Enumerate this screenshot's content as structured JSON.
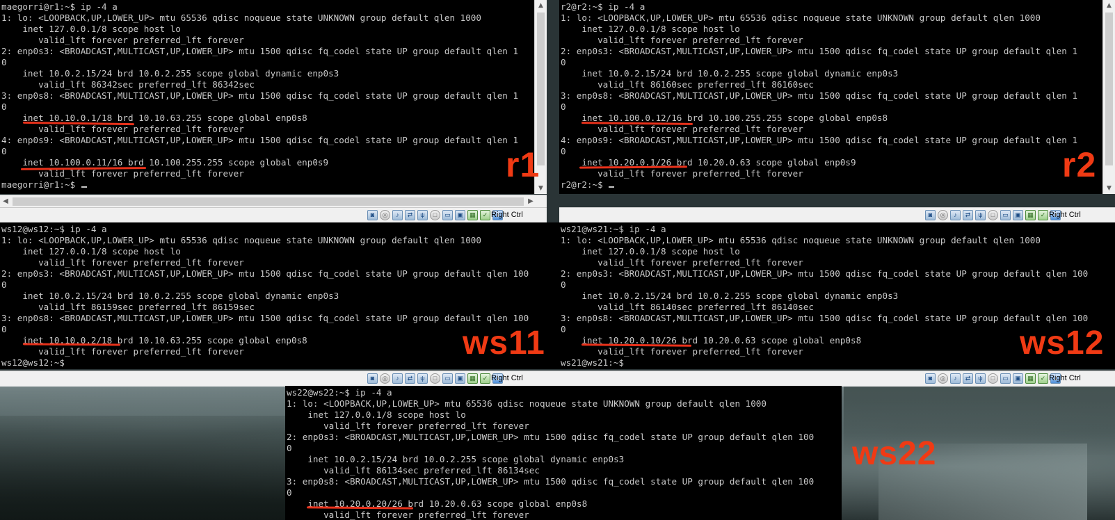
{
  "vms": {
    "r1": {
      "label": "r1",
      "prompt_line": "maegorri@r1:~$ ip -4 a",
      "lines": [
        "1: lo: <LOOPBACK,UP,LOWER_UP> mtu 65536 qdisc noqueue state UNKNOWN group default qlen 1000",
        "    inet 127.0.0.1/8 scope host lo",
        "       valid_lft forever preferred_lft forever",
        "2: enp0s3: <BROADCAST,MULTICAST,UP,LOWER_UP> mtu 1500 qdisc fq_codel state UP group default qlen 1",
        "0",
        "    inet 10.0.2.15/24 brd 10.0.2.255 scope global dynamic enp0s3",
        "       valid_lft 86342sec preferred_lft 86342sec",
        "3: enp0s8: <BROADCAST,MULTICAST,UP,LOWER_UP> mtu 1500 qdisc fq_codel state UP group default qlen 1",
        "0",
        "    inet 10.10.0.1/18 brd 10.10.63.255 scope global enp0s8",
        "       valid_lft forever preferred_lft forever",
        "4: enp0s9: <BROADCAST,MULTICAST,UP,LOWER_UP> mtu 1500 qdisc fq_codel state UP group default qlen 1",
        "0",
        "    inet 10.100.0.11/16 brd 10.100.255.255 scope global enp0s9",
        "       valid_lft forever preferred_lft forever"
      ],
      "final_prompt": "maegorri@r1:~$ "
    },
    "r2": {
      "label": "r2",
      "prompt_line": "r2@r2:~$ ip -4 a",
      "lines": [
        "1: lo: <LOOPBACK,UP,LOWER_UP> mtu 65536 qdisc noqueue state UNKNOWN group default qlen 1000",
        "    inet 127.0.0.1/8 scope host lo",
        "       valid_lft forever preferred_lft forever",
        "2: enp0s3: <BROADCAST,MULTICAST,UP,LOWER_UP> mtu 1500 qdisc fq_codel state UP group default qlen 1",
        "0",
        "    inet 10.0.2.15/24 brd 10.0.2.255 scope global dynamic enp0s3",
        "       valid_lft 86160sec preferred_lft 86160sec",
        "3: enp0s8: <BROADCAST,MULTICAST,UP,LOWER_UP> mtu 1500 qdisc fq_codel state UP group default qlen 1",
        "0",
        "    inet 10.100.0.12/16 brd 10.100.255.255 scope global enp0s8",
        "       valid_lft forever preferred_lft forever",
        "4: enp0s9: <BROADCAST,MULTICAST,UP,LOWER_UP> mtu 1500 qdisc fq_codel state UP group default qlen 1",
        "0",
        "    inet 10.20.0.1/26 brd 10.20.0.63 scope global enp0s9",
        "       valid_lft forever preferred_lft forever"
      ],
      "final_prompt": "r2@r2:~$ "
    },
    "ws11": {
      "label": "ws11",
      "prompt_line": "ws12@ws12:~$ ip -4 a",
      "lines": [
        "1: lo: <LOOPBACK,UP,LOWER_UP> mtu 65536 qdisc noqueue state UNKNOWN group default qlen 1000",
        "    inet 127.0.0.1/8 scope host lo",
        "       valid_lft forever preferred_lft forever",
        "2: enp0s3: <BROADCAST,MULTICAST,UP,LOWER_UP> mtu 1500 qdisc fq_codel state UP group default qlen 100",
        "0",
        "    inet 10.0.2.15/24 brd 10.0.2.255 scope global dynamic enp0s3",
        "       valid_lft 86159sec preferred_lft 86159sec",
        "3: enp0s8: <BROADCAST,MULTICAST,UP,LOWER_UP> mtu 1500 qdisc fq_codel state UP group default qlen 100",
        "0",
        "    inet 10.10.0.2/18 brd 10.10.63.255 scope global enp0s8",
        "       valid_lft forever preferred_lft forever"
      ],
      "final_prompt": "ws12@ws12:~$"
    },
    "ws12": {
      "label": "ws12",
      "prompt_line": "ws21@ws21:~$ ip -4 a",
      "lines": [
        "1: lo: <LOOPBACK,UP,LOWER_UP> mtu 65536 qdisc noqueue state UNKNOWN group default qlen 1000",
        "    inet 127.0.0.1/8 scope host lo",
        "       valid_lft forever preferred_lft forever",
        "2: enp0s3: <BROADCAST,MULTICAST,UP,LOWER_UP> mtu 1500 qdisc fq_codel state UP group default qlen 100",
        "0",
        "    inet 10.0.2.15/24 brd 10.0.2.255 scope global dynamic enp0s3",
        "       valid_lft 86140sec preferred_lft 86140sec",
        "3: enp0s8: <BROADCAST,MULTICAST,UP,LOWER_UP> mtu 1500 qdisc fq_codel state UP group default qlen 100",
        "0",
        "    inet 10.20.0.10/26 brd 10.20.0.63 scope global enp0s8",
        "       valid_lft forever preferred_lft forever"
      ],
      "final_prompt": "ws21@ws21:~$"
    },
    "ws22": {
      "label": "ws22",
      "prompt_line": "ws22@ws22:~$ ip -4 a",
      "lines": [
        "1: lo: <LOOPBACK,UP,LOWER_UP> mtu 65536 qdisc noqueue state UNKNOWN group default qlen 1000",
        "    inet 127.0.0.1/8 scope host lo",
        "       valid_lft forever preferred_lft forever",
        "2: enp0s3: <BROADCAST,MULTICAST,UP,LOWER_UP> mtu 1500 qdisc fq_codel state UP group default qlen 100",
        "0",
        "    inet 10.0.2.15/24 brd 10.0.2.255 scope global dynamic enp0s3",
        "       valid_lft 86134sec preferred_lft 86134sec",
        "3: enp0s8: <BROADCAST,MULTICAST,UP,LOWER_UP> mtu 1500 qdisc fq_codel state UP group default qlen 100",
        "0",
        "    inet 10.20.0.20/26 brd 10.20.0.63 scope global enp0s8",
        "       valid_lft forever preferred_lft forever"
      ]
    }
  },
  "statusbar": {
    "host_key": "Right Ctrl"
  },
  "colors": {
    "terminal_bg": "#000000",
    "terminal_fg": "#c9c9c9",
    "annotation": "#f03a14",
    "underline": "#e8311a"
  }
}
